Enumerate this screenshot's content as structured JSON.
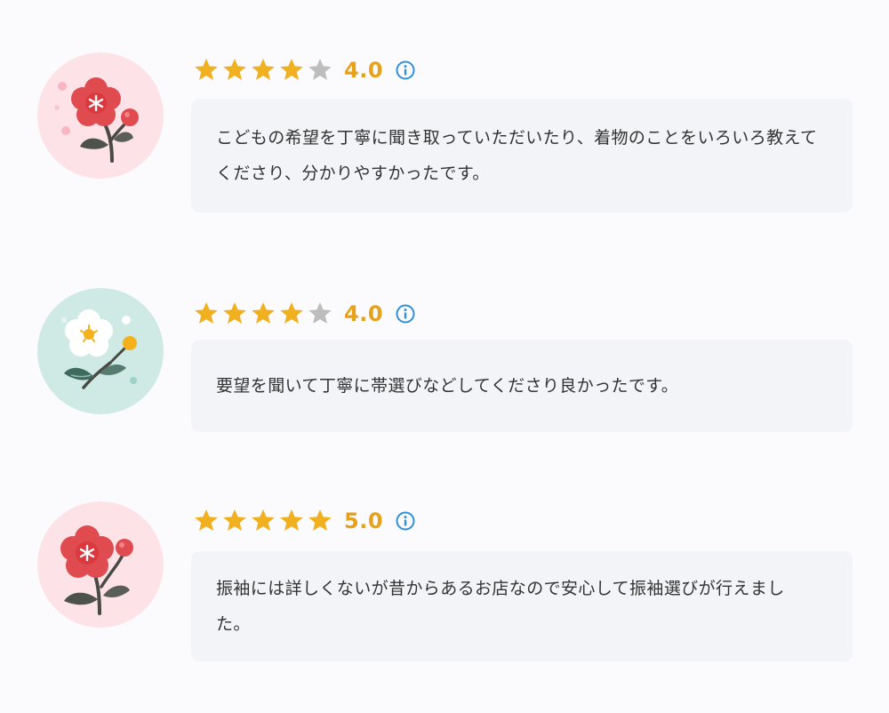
{
  "colors": {
    "star_filled": "#f0b020",
    "star_empty": "#bdbdbd",
    "score_text": "#e8a21a",
    "info_icon": "#2f8fd8",
    "comment_bg": "#f3f4f8",
    "avatar_pink_bg": "#fde3e8",
    "avatar_mint_bg": "#cfe9e4"
  },
  "reviews": [
    {
      "avatar": "red-plum-blossom-icon",
      "rating": 4,
      "max_rating": 5,
      "score": "4.0",
      "comment": "こどもの希望を丁寧に聞き取っていただいたり、着物のことをいろいろ教えてくださり、分かりやすかったです。"
    },
    {
      "avatar": "white-plum-blossom-icon",
      "rating": 4,
      "max_rating": 5,
      "score": "4.0",
      "comment": "要望を聞いて丁寧に帯選びなどしてくださり良かったです。"
    },
    {
      "avatar": "red-plum-blossom-icon",
      "rating": 5,
      "max_rating": 5,
      "score": "5.0",
      "comment": "振袖には詳しくないが昔からあるお店なので安心して振袖選びが行えました。"
    }
  ]
}
